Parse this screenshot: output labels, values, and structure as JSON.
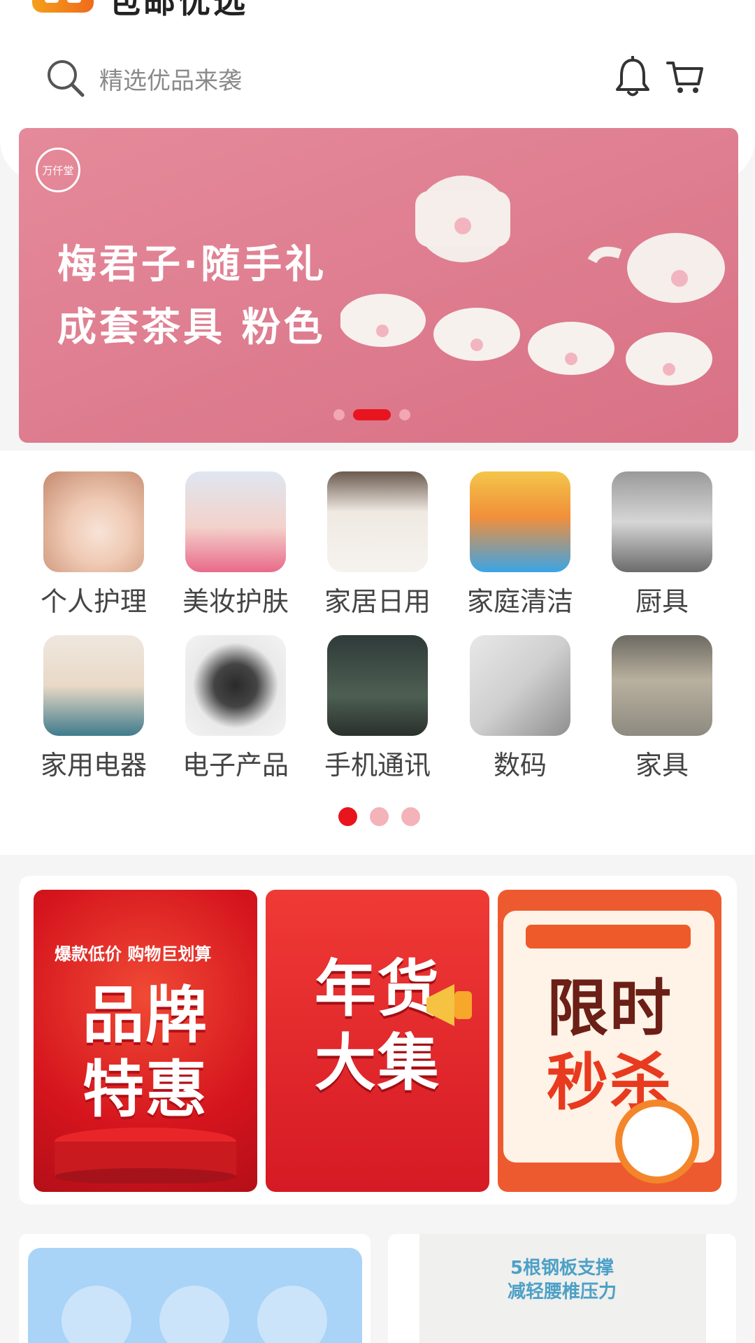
{
  "header": {
    "brand": "包邮优选",
    "search_placeholder": "精选优品来袭"
  },
  "banner": {
    "badge": "万仟堂",
    "line1": "梅君子·随手礼",
    "line2": "成套茶具 粉色",
    "dots_count": 3,
    "active_dot": 1
  },
  "categories": [
    {
      "label": "个人护理",
      "icon": "face-mask-photo"
    },
    {
      "label": "美妆护肤",
      "icon": "cosmetics-photo"
    },
    {
      "label": "家居日用",
      "icon": "storage-bins-photo"
    },
    {
      "label": "家庭清洁",
      "icon": "cleaning-supplies-photo"
    },
    {
      "label": "厨具",
      "icon": "cookware-photo"
    },
    {
      "label": "家用电器",
      "icon": "appliances-photo"
    },
    {
      "label": "电子产品",
      "icon": "smartwatch-photo"
    },
    {
      "label": "手机通讯",
      "icon": "smartphone-photo"
    },
    {
      "label": "数码",
      "icon": "digital-devices-photo"
    },
    {
      "label": "家具",
      "icon": "furniture-photo"
    }
  ],
  "category_pager": {
    "count": 3,
    "active": 0
  },
  "promos": [
    {
      "subtitle": "爆款低价 购物巨划算",
      "title1": "品牌",
      "title2": "特惠"
    },
    {
      "subtitle": "",
      "title1": "年货",
      "title2": "大集"
    },
    {
      "subtitle": "",
      "title1": "限时",
      "title2": "秒杀"
    }
  ],
  "bottom": {
    "right_line1": "5根钢板支撑",
    "right_line2": "减轻腰椎压力"
  },
  "colors": {
    "accent": "#e8151e",
    "banner_pink": "#df7f91",
    "header_bg": "#ffffff",
    "page_bg": "#f5f5f5"
  }
}
